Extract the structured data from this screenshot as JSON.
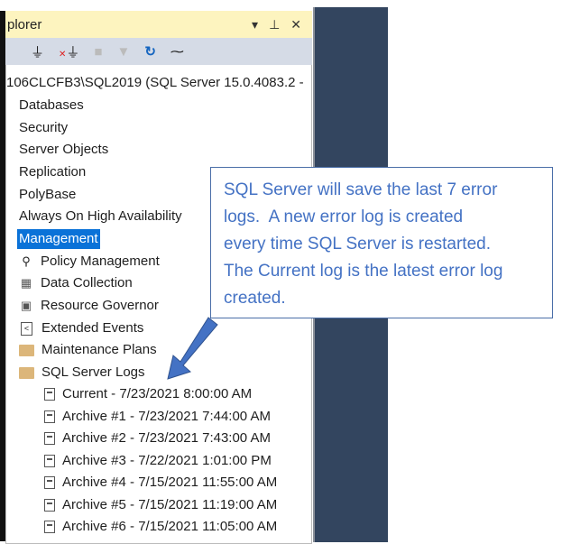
{
  "panel": {
    "title": "plorer",
    "title_icons": [
      "dropdown-arrow-icon",
      "pin-icon",
      "close-icon"
    ],
    "toolbar_icons": [
      "connect-icon",
      "disconnect-icon",
      "stop-icon",
      "filter-icon",
      "refresh-icon",
      "activity-monitor-icon"
    ]
  },
  "tree": {
    "server": "106CLCFB3\\SQL2019 (SQL Server 15.0.4083.2 - ",
    "top_items": [
      "Databases",
      "Security",
      "Server Objects",
      "Replication",
      "PolyBase",
      "Always On High Availability"
    ],
    "selected": "Management",
    "management_children": [
      "Policy Management",
      "Data Collection",
      "Resource Governor",
      "Extended Events",
      "Maintenance Plans",
      "SQL Server Logs"
    ],
    "logs": [
      "Current - 7/23/2021 8:00:00 AM",
      "Archive #1 - 7/23/2021 7:44:00 AM",
      "Archive #2 - 7/23/2021 7:43:00 AM",
      "Archive #3 - 7/22/2021 1:01:00 PM",
      "Archive #4 - 7/15/2021 11:55:00 AM",
      "Archive #5 - 7/15/2021 11:19:00 AM",
      "Archive #6 - 7/15/2021 11:05:00 AM"
    ]
  },
  "callout": {
    "lines": [
      "SQL Server will save the last 7 error",
      "logs.  A new error log is created",
      "every time SQL Server is restarted.",
      "The Current log is the latest error log",
      "created."
    ],
    "color": "#4472c4"
  }
}
